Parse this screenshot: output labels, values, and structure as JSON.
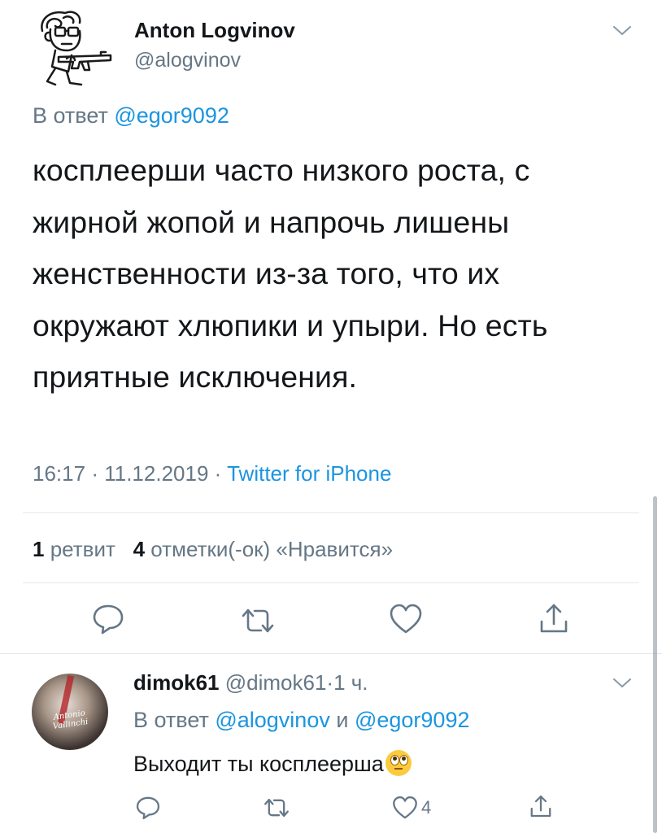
{
  "colors": {
    "link": "#1b95e0",
    "secondary": "#657786",
    "text": "#14171a",
    "divider": "#e1e8ed"
  },
  "tweet": {
    "author_name": "Anton Logvinov",
    "author_handle": "@alogvinov",
    "replying_prefix": "В ответ",
    "replying_to": "@egor9092",
    "text_lines": [
      "косплеерши часто низкого роста, с",
      "жирной жопой и напрочь лишены",
      "женственности из-за того, что их",
      "окружают хлюпики и упыри. Но есть",
      "приятные исключения."
    ],
    "time": "16:17",
    "date": "11.12.2019",
    "separator": "·",
    "source": "Twitter for iPhone",
    "retweets_count": "1",
    "retweets_label": "ретвит",
    "likes_count": "4",
    "likes_label": "отметки(-ок) «Нравится»",
    "icons": [
      "chevron-down-icon",
      "reply-icon",
      "retweet-icon",
      "like-icon",
      "share-icon"
    ]
  },
  "reply": {
    "author_name": "dimok61",
    "author_handle": "@dimok61",
    "separator": "·",
    "time": "1 ч.",
    "replying_prefix": "В ответ",
    "replying_to_1": "@alogvinov",
    "conj": "и",
    "replying_to_2": "@egor9092",
    "text": "Выходит ты косплеерша",
    "emoji": "face-with-rolling-eyes",
    "avatar_signature": "Antonio Vallinchi",
    "like_count": "4"
  }
}
